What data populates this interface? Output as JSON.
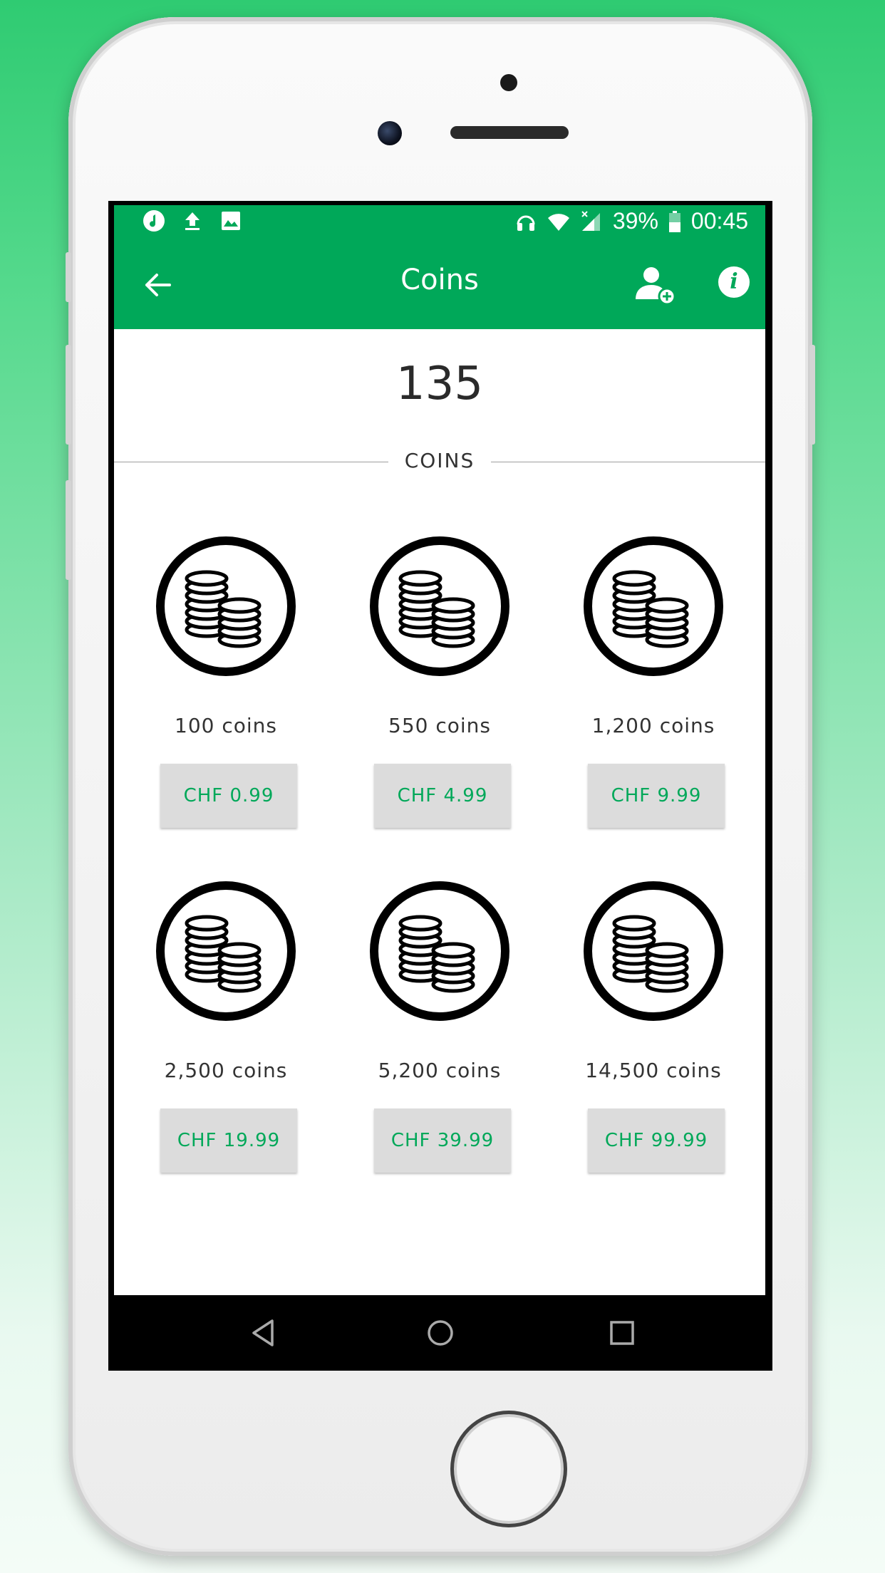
{
  "status_bar": {
    "left_icons": [
      "music-note-icon",
      "upload-icon",
      "image-icon"
    ],
    "right_icons": [
      "headphones-icon",
      "wifi-icon",
      "cell-signal-icon",
      "battery-icon"
    ],
    "battery": "39%",
    "time": "00:45"
  },
  "app_bar": {
    "title": "Coins",
    "back_icon": "arrow-left-icon",
    "add_user_icon": "add-user-icon",
    "info_icon": "info-icon",
    "info_glyph": "i"
  },
  "balance": {
    "value": "135",
    "label": "COINS"
  },
  "packages": [
    {
      "amount": "100 coins",
      "price": "CHF 0.99",
      "icon": "coin-stack-icon"
    },
    {
      "amount": "550 coins",
      "price": "CHF 4.99",
      "icon": "coin-stack-icon"
    },
    {
      "amount": "1,200 coins",
      "price": "CHF 9.99",
      "icon": "coin-stack-icon"
    },
    {
      "amount": "2,500 coins",
      "price": "CHF 19.99",
      "icon": "coin-stack-icon"
    },
    {
      "amount": "5,200 coins",
      "price": "CHF 39.99",
      "icon": "coin-stack-icon"
    },
    {
      "amount": "14,500 coins",
      "price": "CHF 99.99",
      "icon": "coin-stack-icon"
    }
  ],
  "nav_bar": {
    "icons": [
      "back-triangle-icon",
      "home-circle-icon",
      "recents-square-icon"
    ]
  },
  "colors": {
    "accent": "#00a859",
    "background_top": "#2fcb72",
    "button_bg": "#dcdcdc"
  }
}
